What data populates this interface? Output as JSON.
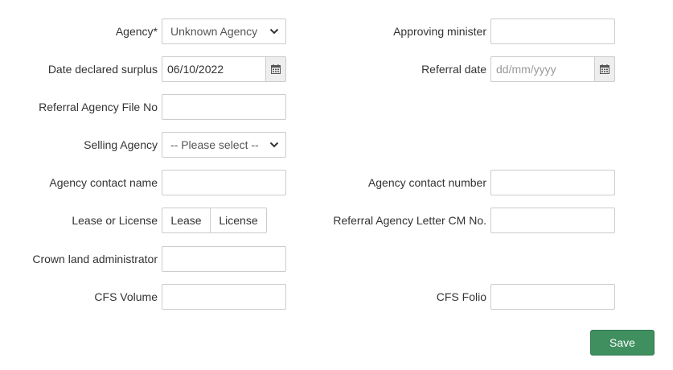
{
  "form": {
    "agency": {
      "label": "Agency",
      "required_mark": "*",
      "value": "Unknown Agency"
    },
    "approving_minister": {
      "label": "Approving minister",
      "value": ""
    },
    "date_declared_surplus": {
      "label": "Date declared surplus",
      "value": "06/10/2022"
    },
    "referral_date": {
      "label": "Referral date",
      "placeholder": "dd/mm/yyyy"
    },
    "referral_agency_file_no": {
      "label": "Referral Agency File No",
      "value": ""
    },
    "selling_agency": {
      "label": "Selling Agency",
      "value": "-- Please select --"
    },
    "agency_contact_name": {
      "label": "Agency contact name",
      "value": ""
    },
    "agency_contact_number": {
      "label": "Agency contact number",
      "value": ""
    },
    "lease_or_license": {
      "label": "Lease or License",
      "options": [
        "Lease",
        "License"
      ]
    },
    "referral_agency_letter_cm_no": {
      "label": "Referral Agency Letter CM No.",
      "value": ""
    },
    "crown_land_administrator": {
      "label": "Crown land administrator",
      "value": ""
    },
    "cfs_volume": {
      "label": "CFS Volume",
      "value": ""
    },
    "cfs_folio": {
      "label": "CFS Folio",
      "value": ""
    }
  },
  "actions": {
    "save_label": "Save"
  },
  "icons": {
    "calendar": "calendar-icon",
    "dropdown": "chevron-down-icon"
  },
  "colors": {
    "save_button": "#3f8f5f",
    "border": "#cccccc",
    "addon_bg": "#eeeeee"
  }
}
